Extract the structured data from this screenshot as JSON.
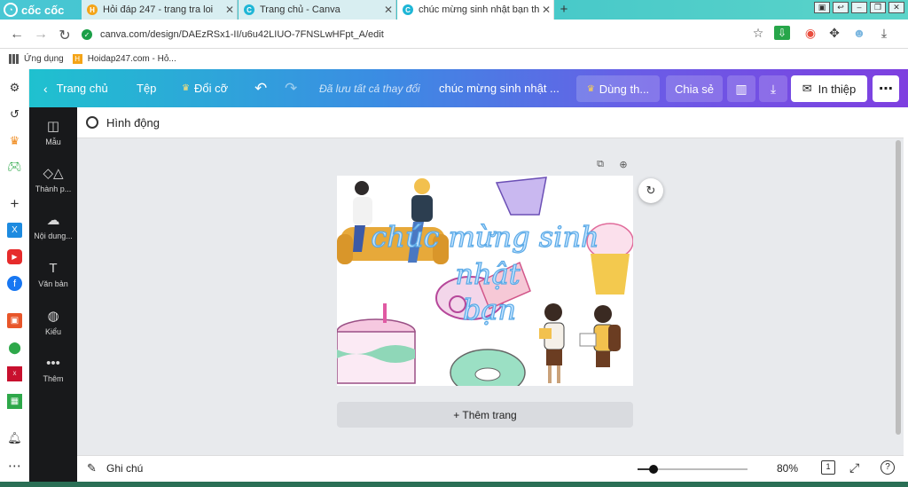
{
  "browser": {
    "brand": "cốc cốc",
    "tabs": [
      {
        "title": "Hỏi đáp 247 - trang tra loi",
        "favicon_color": "#f4a417",
        "favicon_glyph": "H"
      },
      {
        "title": "Trang chủ - Canva",
        "favicon_color": "#1fb6d6",
        "favicon_glyph": "C"
      },
      {
        "title": "chúc mừng sinh nhật bạn th",
        "favicon_color": "#1fb6d6",
        "favicon_glyph": "C"
      }
    ],
    "new_tab": "+",
    "url": "canva.com/design/DAEzRSx1-II/u6u42LIUO-7FNSLwHFpt_A/edit",
    "bookmarks": [
      {
        "label": "Ứng dụng",
        "icon": "apps-grid-icon"
      },
      {
        "label": "Hoidap247.com - Hỏ...",
        "icon": "hoidap-icon"
      }
    ],
    "sidebar_icons": [
      "gear-icon",
      "history-icon",
      "crown-icon",
      "gamepad-icon",
      "plus-icon",
      "twitter-icon",
      "youtube-icon",
      "facebook-icon",
      "shopping-icon",
      "map-icon",
      "xmas-icon",
      "sheet-icon",
      "bell-icon",
      "more-icon"
    ]
  },
  "canva": {
    "header": {
      "home": "Trang chủ",
      "file": "Tệp",
      "resize": "Đổi cỡ",
      "saved": "Đã lưu tất cả thay đổi",
      "title": "chúc mừng sinh nhật ...",
      "try": "Dùng th...",
      "share": "Chia sẻ",
      "print": "In thiệp"
    },
    "rail": [
      {
        "label": "Mẫu",
        "icon": "template-icon"
      },
      {
        "label": "Thành p...",
        "icon": "elements-icon"
      },
      {
        "label": "Nội dung...",
        "icon": "upload-icon"
      },
      {
        "label": "Văn bản",
        "icon": "text-icon"
      },
      {
        "label": "Kiểu",
        "icon": "palette-icon"
      },
      {
        "label": "Thêm",
        "icon": "more-dots-icon"
      }
    ],
    "animate": "Hình động",
    "design_text": [
      "chúc mừng sinh",
      "nhật",
      "bạn"
    ],
    "add_page": "+ Thêm trang",
    "notes": "Ghi chú",
    "zoom": "80%",
    "page_count": "1",
    "zoom_level": 0.4,
    "help": "?"
  }
}
